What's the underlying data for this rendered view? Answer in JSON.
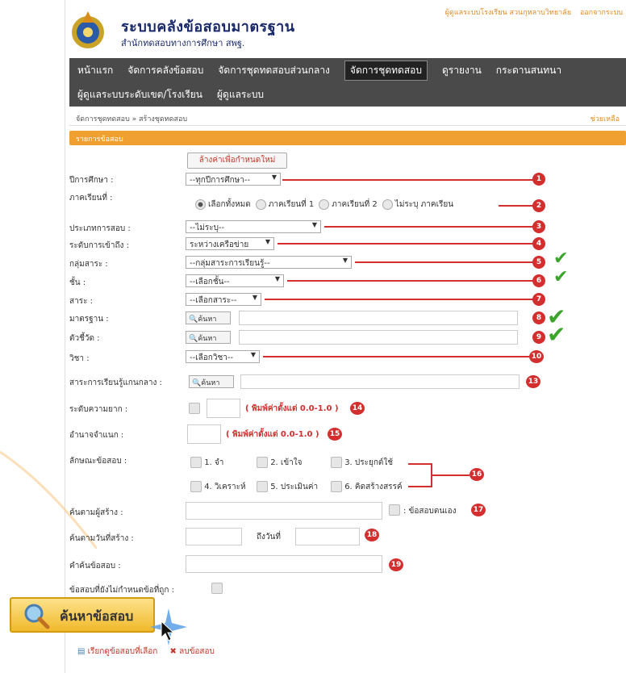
{
  "header": {
    "user_link": "ผู้ดูแลระบบโรงเรียน สวนกุหลาบวิทยาลัย",
    "logout": "ออกจากระบบ",
    "title": "ระบบคลังข้อสอบมาตรฐาน",
    "subtitle": "สำนักทดสอบทางการศึกษา สพฐ."
  },
  "nav": {
    "row1": [
      "หน้าแรก",
      "จัดการคลังข้อสอบ",
      "จัดการชุดทดสอบส่วนกลาง",
      "จัดการชุดทดสอบ",
      "ดูรายงาน",
      "กระดานสนทนา"
    ],
    "row2": [
      "ผู้ดูแลระบบระดับเขต/โรงเรียน",
      "ผู้ดูแลระบบ"
    ],
    "active": "จัดการชุดทดสอบ"
  },
  "breadcrumb": "จัดการชุดทดสอบ » สร้างชุดทดสอบ",
  "help": "ช่วยเหลือ",
  "section_title": "รายการข้อสอบ",
  "reset_label": "ล้างค่าเพื่อกำหนดใหม่",
  "form": {
    "year_label": "ปีการศึกษา :",
    "year_value": "--ทุกปีการศึกษา--",
    "term_label": "ภาคเรียนที่ :",
    "term_options": [
      "เลือกทั้งหมด",
      "ภาคเรียนที่ 1",
      "ภาคเรียนที่ 2",
      "ไม่ระบุ ภาคเรียน"
    ],
    "exam_type_label": "ประเภทการสอบ :",
    "exam_type_value": "--ไม่ระบุ--",
    "access_label": "ระดับการเข้าถึง :",
    "access_value": "ระหว่างเครือข่าย",
    "group_label": "กลุ่มสาระ :",
    "group_value": "--กลุ่มสาระการเรียนรู้--",
    "grade_label": "ชั้น :",
    "grade_value": "--เลือกชั้น--",
    "subject_label": "สาระ :",
    "subject_value": "--เลือกสาระ--",
    "standard_label": "มาตรฐาน :",
    "indicator_label": "ตัวชี้วัด :",
    "course_label": "วิชา :",
    "course_value": "--เลือกวิชา--",
    "core_label": "สาระการเรียนรู้แกนกลาง :",
    "search_btn": "ค้นหา",
    "difficulty_label": "ระดับความยาก :",
    "difficulty_hint": "( พิมพ์ค่าตั้งแต่ 0.0-1.0 )",
    "discrimination_label": "อำนาจจำแนก :",
    "discrimination_hint": "( พิมพ์ค่าตั้งแต่ 0.0-1.0 )",
    "nature_label": "ลักษณะข้อสอบ :",
    "nature_options": [
      "1. จำ",
      "2. เข้าใจ",
      "3. ประยุกต์ใช้",
      "4. วิเคราะห์",
      "5. ประเมินค่า",
      "6. คิดสร้างสรรค์"
    ],
    "creator_label": "ค้นตามผู้สร้าง :",
    "own_label": ": ข้อสอบตนเอง",
    "date_label": "ค้นตามวันที่สร้าง :",
    "to_date_label": "ถึงวันที่",
    "keyword_label": "คำค้นข้อสอบ :",
    "no_answer_label": "ข้อสอบที่ยังไม่กำหนดข้อที่ถูก :"
  },
  "badges": [
    "1",
    "2",
    "3",
    "4",
    "5",
    "6",
    "7",
    "8",
    "9",
    "10",
    "13",
    "14",
    "15",
    "16",
    "17",
    "18",
    "19"
  ],
  "search_big_label": "ค้นหาข้อสอบ",
  "bottom_links": {
    "view": "เรียกดูข้อสอบที่เลือก",
    "delete": "ลบข้อสอบ"
  },
  "colors": {
    "accent": "#f0a030",
    "nav": "#4a4a4a",
    "marker": "#d32f2f",
    "check": "#3aa52a"
  }
}
